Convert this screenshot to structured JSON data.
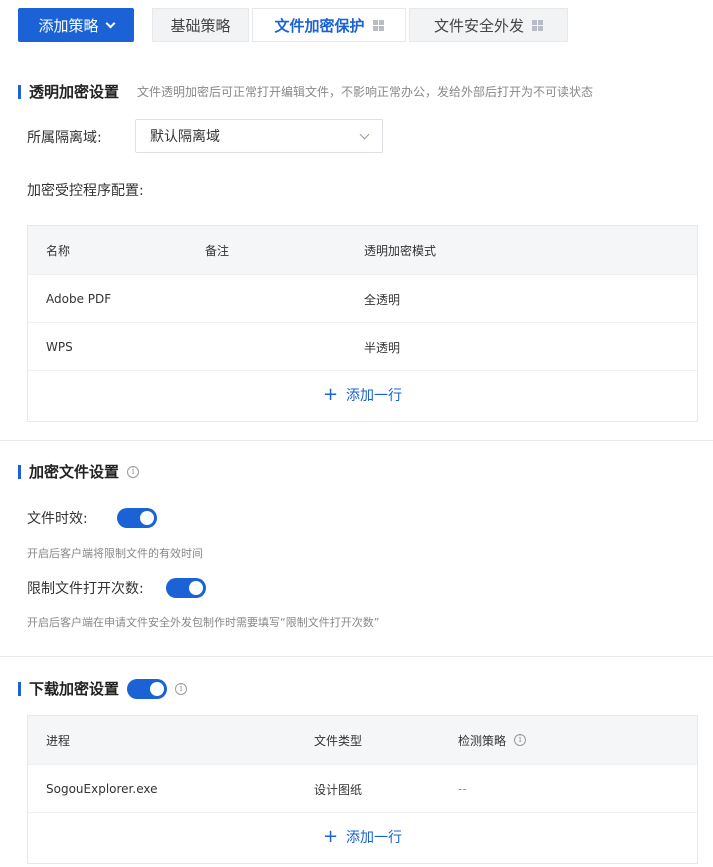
{
  "toolbar": {
    "add_policy_label": "添加策略"
  },
  "tabs": [
    {
      "label": "基础策略"
    },
    {
      "label": "文件加密保护"
    },
    {
      "label": "文件安全外发"
    }
  ],
  "transparent_encryption": {
    "title": "透明加密设置",
    "description": "文件透明加密后可正常打开编辑文件，不影响正常办公，发给外部后打开为不可读状态",
    "isolation_label": "所属隔离域:",
    "isolation_value": "默认隔离域",
    "program_config_label": "加密受控程序配置:",
    "table": {
      "headers": [
        "名称",
        "备注",
        "透明加密模式"
      ],
      "rows": [
        {
          "name": "Adobe PDF",
          "note": "",
          "mode": "全透明"
        },
        {
          "name": "WPS",
          "note": "",
          "mode": "半透明"
        }
      ],
      "add_row_label": "添加一行"
    }
  },
  "encrypted_file": {
    "title": "加密文件设置",
    "validity_label": "文件时效:",
    "validity_enabled": true,
    "validity_hint": "开启后客户端将限制文件的有效时间",
    "open_limit_label": "限制文件打开次数:",
    "open_limit_enabled": true,
    "open_limit_hint": "开启后客户端在申请文件安全外发包制作时需要填写“限制文件打开次数”"
  },
  "download_encryption": {
    "title": "下载加密设置",
    "enabled": true,
    "table": {
      "headers": [
        "进程",
        "文件类型",
        "检测策略"
      ],
      "rows": [
        {
          "process": "SogouExplorer.exe",
          "file_type": "设计图纸",
          "policy": "--"
        }
      ],
      "add_row_label": "添加一行"
    }
  },
  "colors": {
    "accent": "#1a62d6",
    "border": "#e6e8eb",
    "header_bg": "#f5f6f8"
  },
  "icons": [
    "chevron-down-icon",
    "windows-icon",
    "info-icon",
    "plus-icon"
  ]
}
